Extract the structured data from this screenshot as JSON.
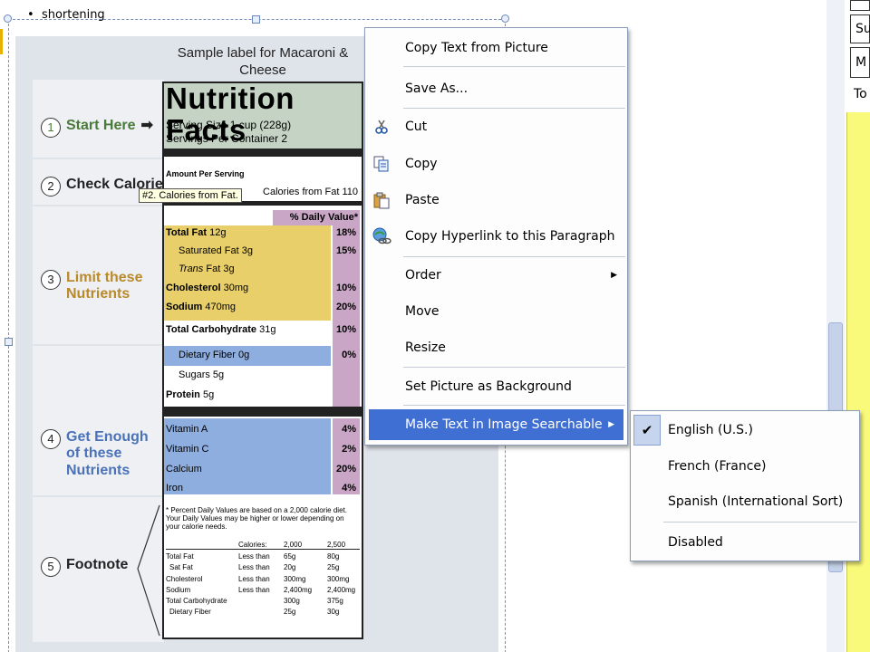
{
  "document": {
    "bullet_text": "shortening",
    "tooltip_text": "#2. Calories from Fat."
  },
  "nutrition_label": {
    "header": "Sample label for Macaroni & Cheese",
    "title": "Nutrition Facts",
    "serving_size": "Serving Size 1 cup (228g)",
    "servings_per_container": "Servings Per Container  2",
    "amount_per_serving": "Amount Per Serving",
    "calories_from_fat": "Calories from Fat 110",
    "daily_value_header": "% Daily Value*",
    "steps": [
      {
        "num": "1",
        "label": "Start Here",
        "arrow": "➡"
      },
      {
        "num": "2",
        "label": "Check Calories"
      },
      {
        "num": "3",
        "label": "Limit these Nutrients"
      },
      {
        "num": "4",
        "label": "Get Enough of these Nutrients"
      },
      {
        "num": "5",
        "label": "Footnote"
      }
    ],
    "nutrients": [
      {
        "name": "Total Fat",
        "amount": "12g",
        "pct": "18%"
      },
      {
        "name": "Saturated Fat",
        "amount": "3g",
        "pct": "15%"
      },
      {
        "name": "Trans",
        "amount": "Fat 3g",
        "pct": ""
      },
      {
        "name": "Cholesterol",
        "amount": "30mg",
        "pct": "10%"
      },
      {
        "name": "Sodium",
        "amount": "470mg",
        "pct": "20%"
      },
      {
        "name": "Total Carbohydrate",
        "amount": "31g",
        "pct": "10%"
      },
      {
        "name": "Dietary Fiber",
        "amount": "0g",
        "pct": "0%"
      },
      {
        "name": "Sugars",
        "amount": "5g",
        "pct": ""
      },
      {
        "name": "Protein",
        "amount": "5g",
        "pct": ""
      }
    ],
    "vitamins": [
      {
        "name": "Vitamin A",
        "pct": "4%"
      },
      {
        "name": "Vitamin C",
        "pct": "2%"
      },
      {
        "name": "Calcium",
        "pct": "20%"
      },
      {
        "name": "Iron",
        "pct": "4%"
      }
    ],
    "footnote_text": "* Percent Daily Values are based on a 2,000 calorie diet. Your Daily Values may be higher or lower depending on your calorie needs.",
    "footnote_table": {
      "header": [
        "",
        "Calories:",
        "2,000",
        "2,500"
      ],
      "rows": [
        [
          "Total Fat",
          "Less than",
          "65g",
          "80g"
        ],
        [
          "Sat Fat",
          "Less than",
          "20g",
          "25g"
        ],
        [
          "Cholesterol",
          "Less than",
          "300mg",
          "300mg"
        ],
        [
          "Sodium",
          "Less than",
          "2,400mg",
          "2,400mg"
        ],
        [
          "Total Carbohydrate",
          "",
          "300g",
          "375g"
        ],
        [
          "Dietary Fiber",
          "",
          "25g",
          "30g"
        ]
      ]
    }
  },
  "right_strip": {
    "cells": [
      "Su",
      "M",
      "To"
    ]
  },
  "context_menu": {
    "items": [
      {
        "label": "Copy Text from Picture",
        "icon": ""
      },
      {
        "label": "Save As...",
        "icon": ""
      },
      {
        "label": "Cut",
        "icon": "scissors-icon"
      },
      {
        "label": "Copy",
        "icon": "copy-icon"
      },
      {
        "label": "Paste",
        "icon": "paste-icon"
      },
      {
        "label": "Copy Hyperlink to this Paragraph",
        "icon": "hyperlink-icon"
      },
      {
        "label": "Order",
        "icon": "",
        "submenu": true
      },
      {
        "label": "Move",
        "icon": ""
      },
      {
        "label": "Resize",
        "icon": ""
      },
      {
        "label": "Set Picture as Background",
        "icon": ""
      },
      {
        "label": "Make Text in Image Searchable",
        "icon": "",
        "submenu": true
      }
    ],
    "submenu": {
      "items": [
        {
          "label": "English (U.S.)",
          "checked": true
        },
        {
          "label": "French (France)",
          "checked": false
        },
        {
          "label": "Spanish (International Sort)",
          "checked": false
        },
        {
          "label": "Disabled",
          "checked": false
        }
      ]
    }
  },
  "colors": {
    "highlight": "#3f6fd3",
    "limit_yellow": "#e8cf6a",
    "enough_blue": "#8eaee0",
    "daily_value_pink": "#c9a6c6",
    "serving_green": "#c5d3c4"
  }
}
